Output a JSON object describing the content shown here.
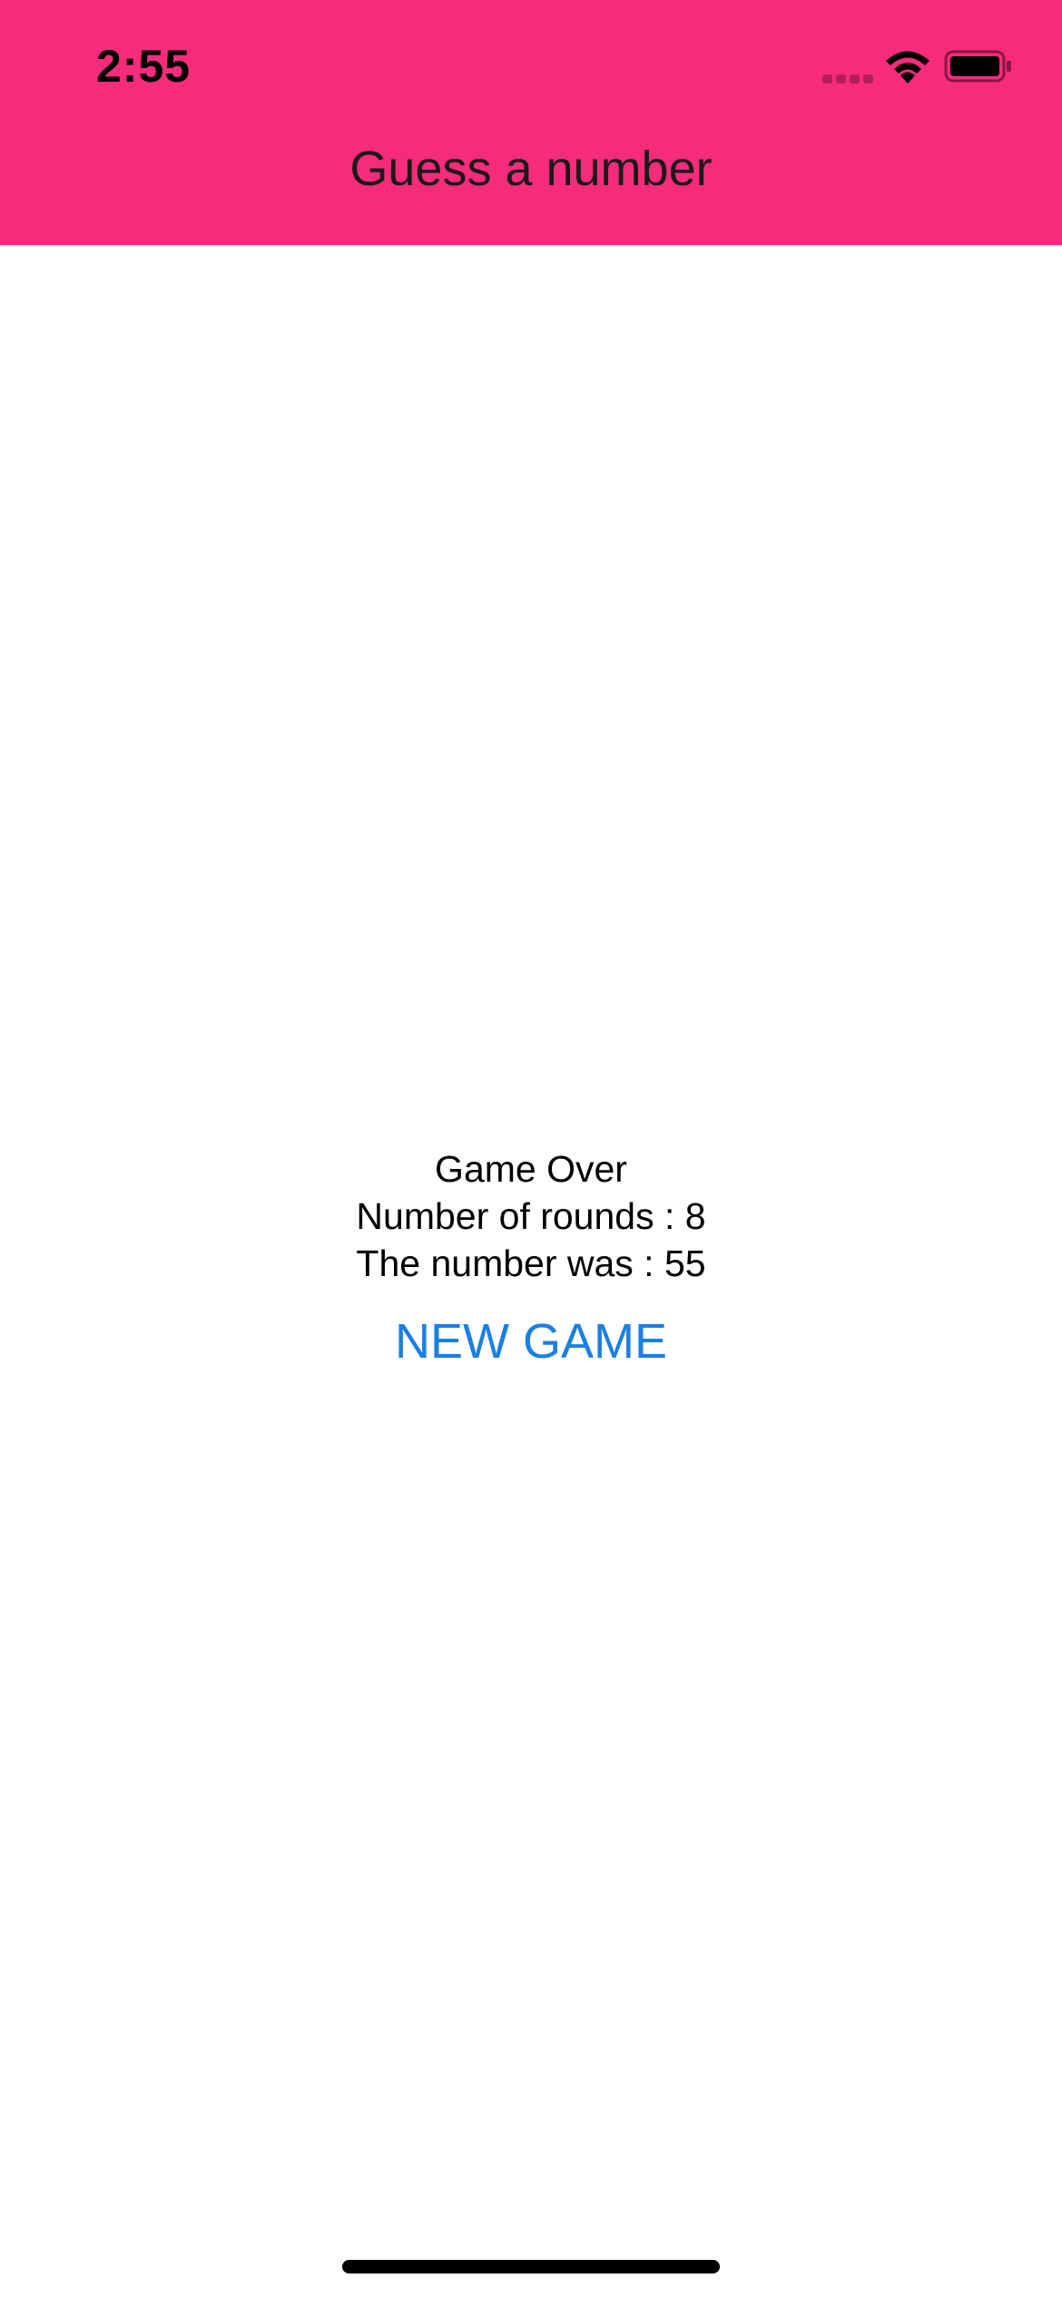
{
  "status_bar": {
    "time": "2:55",
    "signal_icon": "cellular-signal-icon",
    "wifi_icon": "wifi-icon",
    "battery_icon": "battery-icon"
  },
  "nav": {
    "title": "Guess a number",
    "background_color": "#f72b7c"
  },
  "game_over": {
    "heading": "Game Over",
    "rounds_text": "Number of rounds : 8",
    "number_text": "The number was : 55",
    "new_game_label": "NEW GAME",
    "accent_color": "#1a7fe5"
  }
}
